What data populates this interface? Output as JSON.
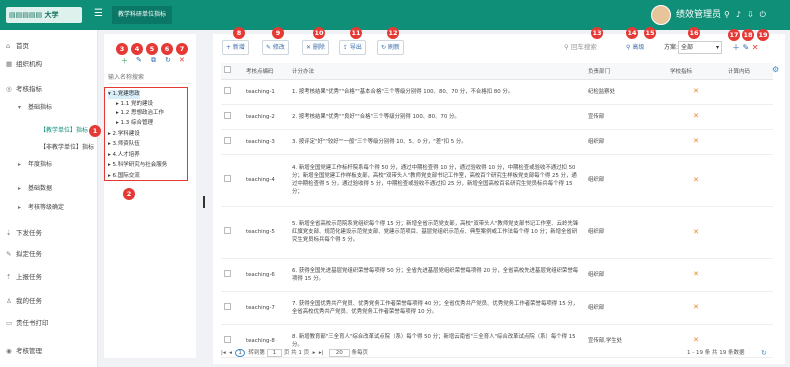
{
  "app": {
    "logo_text": "▤▤▤▤▤ 大学",
    "module_tab": "教学科研单位指标",
    "user_name": "绩效管理员"
  },
  "sidebar": {
    "items": [
      {
        "label": "首页",
        "icon": "⌂"
      },
      {
        "label": "组织机构",
        "icon": "▦"
      },
      {
        "label": "考核指标",
        "icon": "◎"
      },
      {
        "label": "基础指标",
        "icon": "▾"
      },
      {
        "label": "【教学单位】指标",
        "icon": ""
      },
      {
        "label": "【非教学单位】指标",
        "icon": ""
      },
      {
        "label": "年度指标",
        "icon": "▸"
      },
      {
        "label": "基础数据",
        "icon": "▸"
      },
      {
        "label": "考核等级确定",
        "icon": "▸"
      },
      {
        "label": "下发任务",
        "icon": "⇣"
      },
      {
        "label": "拟定任务",
        "icon": "✎"
      },
      {
        "label": "上报任务",
        "icon": "⇡"
      },
      {
        "label": "我的任务",
        "icon": "♙"
      },
      {
        "label": "责任书打印",
        "icon": "▭"
      },
      {
        "label": "考核管理",
        "icon": "◉"
      }
    ]
  },
  "tree": {
    "search_placeholder": "输入名称搜索",
    "nodes": [
      {
        "label": "1.党建思政"
      },
      {
        "label": "1.1 党的建设"
      },
      {
        "label": "1.2 思想政治工作"
      },
      {
        "label": "1.3 综合管理"
      },
      {
        "label": "2.学科建设"
      },
      {
        "label": "3.师资队伍"
      },
      {
        "label": "4.人才培养"
      },
      {
        "label": "5.科学研究与社会服务"
      },
      {
        "label": "6.国际交流"
      }
    ]
  },
  "toolbar": {
    "add": "+ 新增",
    "edit": "✎ 修改",
    "delete": "✕ 删除",
    "export": "⇪ 导出",
    "refresh": "↻ 刷新",
    "search_placeholder": "回车搜索",
    "advanced": "高级",
    "scheme_label": "方案:",
    "scheme_value": "全部"
  },
  "table": {
    "headers": [
      "考核点编码",
      "计分办法",
      "负责部门",
      "学校指标",
      "计算内码"
    ],
    "rows": [
      {
        "code": "teaching-1",
        "method": "1. 按考核结果\"优秀\"\"合格\"\"基本合格\"三个等级分别得 100、80、70 分，不合格扣 80 分。",
        "dept": "纪检监察处",
        "school": "✕"
      },
      {
        "code": "teaching-2",
        "method": "2. 按考核结果\"优秀\"\"良好\"\"合格\"三个等级分别得 100、80、70 分。",
        "dept": "宣传部",
        "school": "✕"
      },
      {
        "code": "teaching-3",
        "method": "3. 按评定\"好\"\"较好\"\"一般\"三个等级分别得 10、5、0 分，\"差\"扣 5 分。",
        "dept": "组织部",
        "school": "✕"
      },
      {
        "code": "teaching-4",
        "method": "4. 新增全国党建工作标杆院系每个得 50 分，通过中期检查得 10 分，通过验收得 10 分，中期检查或验收不通过扣 50 分；新增全国党建工作样板支部，高校\"双带头人\"教师党支部书记工作室，高校百个研究生样板党支部每个得 25 分，通过中期检查得 5 分，通过验收得 5 分，中期检查或验收不通过扣 25 分，新增全国高校百名研究生党员标兵每个得 15 分；",
        "dept": "组织部",
        "school": "✕"
      },
      {
        "code": "teaching-5",
        "method": "5. 新增全省高校示范院系党组织每个得 15 分；新增全省示范党支部，高校\"双带头人\"教师党支部书记工作室、云岭先锋红旗党支部、规范化建设示范党支部、党建示范项目、基层党组织示范点、典型案例或工作法每个得 10 分；新增全省研究生党员标兵每个得 5 分。",
        "dept": "组织部",
        "school": "✕"
      },
      {
        "code": "teaching-6",
        "method": "6. 获得全国先进基层党组织荣誉每项得 50 分；全省先进基层党组织荣誉每项得 20 分，全省高校先进基层党组织荣誉每项得 15 分。",
        "dept": "组织部",
        "school": "✕"
      },
      {
        "code": "teaching-7",
        "method": "7. 获得全国优秀共产党员、优秀党务工作者荣誉每项得 40 分；全省优秀共产党员、优秀党务工作者荣誉每项得 15 分，全省高校优秀共产党员、优秀党务工作者荣誉每项得 10 分。",
        "dept": "组织部",
        "school": "✕"
      },
      {
        "code": "teaching-8",
        "method": "8. 新增教育部\"三全育人\"综合改革试点院（系）每个得 50 分；新增云南省\"三全育人\"综合改革试点院（系）每个得 15 分。",
        "dept": "宣传部,学生处",
        "school": "✕"
      }
    ]
  },
  "pager": {
    "goto_prefix": "转到第",
    "page": "1",
    "of_label": "页 共 1 页",
    "page_size": "20",
    "per_page": "条每页",
    "summary": "1 - 19 条  共 19 条数据"
  },
  "colors": {
    "primary": "#0f8f78",
    "badge": "#e53935",
    "link": "#3a6da8"
  }
}
